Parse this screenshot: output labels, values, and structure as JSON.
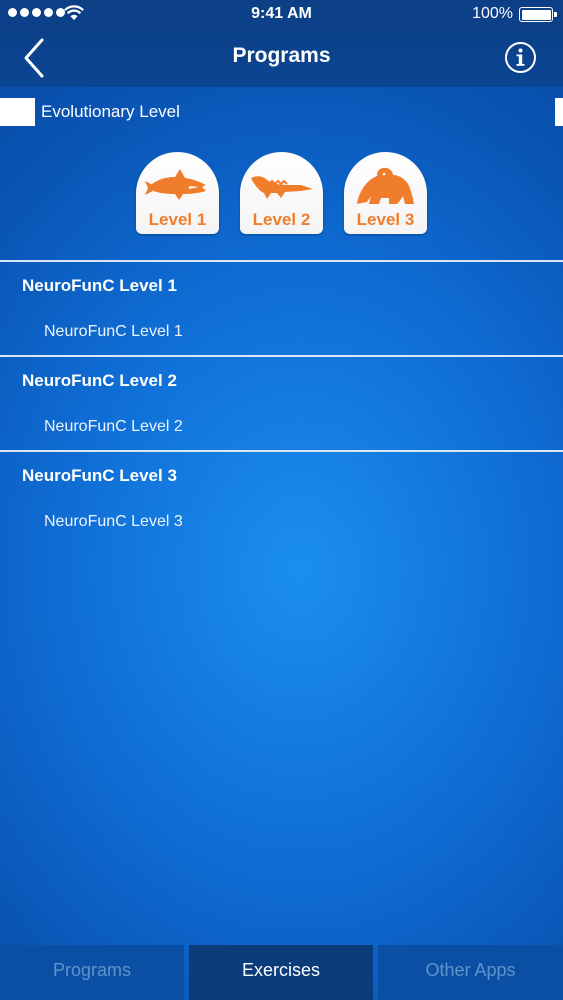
{
  "status_bar": {
    "time": "9:41 AM",
    "battery_percent": "100%"
  },
  "nav": {
    "title": "Programs",
    "back_icon": "chevron-left-icon",
    "info_icon": "info-icon"
  },
  "section": {
    "label": "Evolutionary Level"
  },
  "levels": [
    {
      "label": "Level 1",
      "icon": "shark-icon"
    },
    {
      "label": "Level 2",
      "icon": "crocodile-icon"
    },
    {
      "label": "Level 3",
      "icon": "gorilla-icon"
    }
  ],
  "programs": [
    {
      "title": "NeuroFunC Level 1",
      "item": "NeuroFunC Level 1"
    },
    {
      "title": "NeuroFunC Level 2",
      "item": "NeuroFunC Level 2"
    },
    {
      "title": "NeuroFunC Level 3",
      "item": "NeuroFunC Level 3"
    }
  ],
  "tabs": [
    {
      "label": "Programs",
      "active": false
    },
    {
      "label": "Exercises",
      "active": true
    },
    {
      "label": "Other Apps",
      "active": false
    }
  ],
  "colors": {
    "accent_orange": "#f07d2c",
    "nav_blue": "#0c3f86",
    "background_blue": "#0f6ed6"
  }
}
